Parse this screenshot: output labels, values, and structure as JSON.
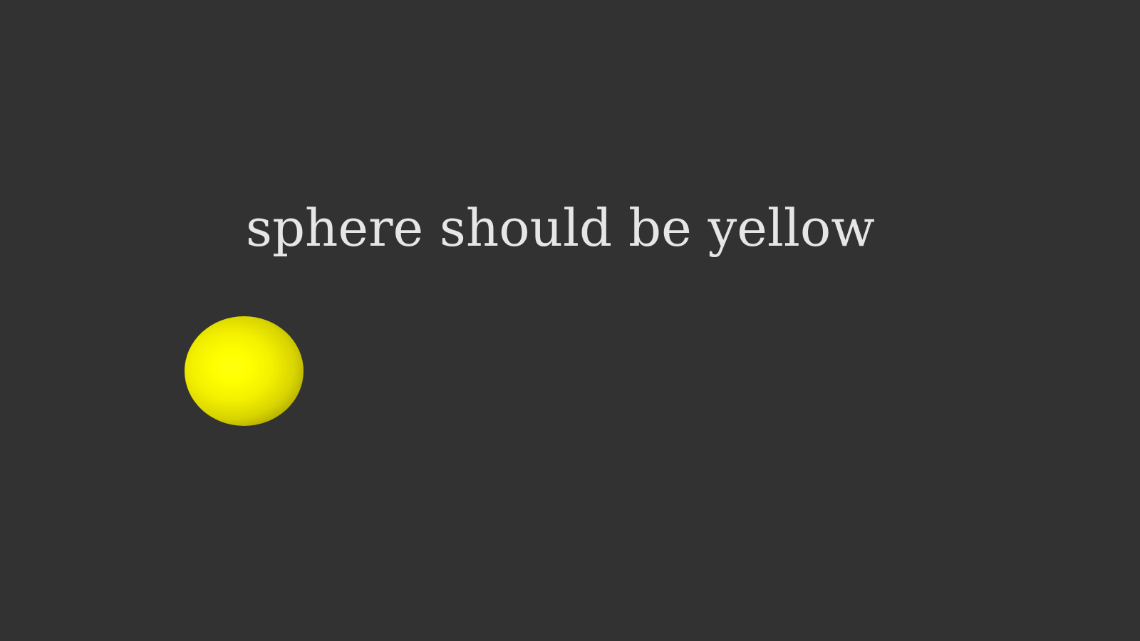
{
  "scene": {
    "caption": "sphere should be yellow",
    "background_color": "#323232",
    "text_color": "#e6e6e6",
    "sphere_color": "#ffff00"
  }
}
